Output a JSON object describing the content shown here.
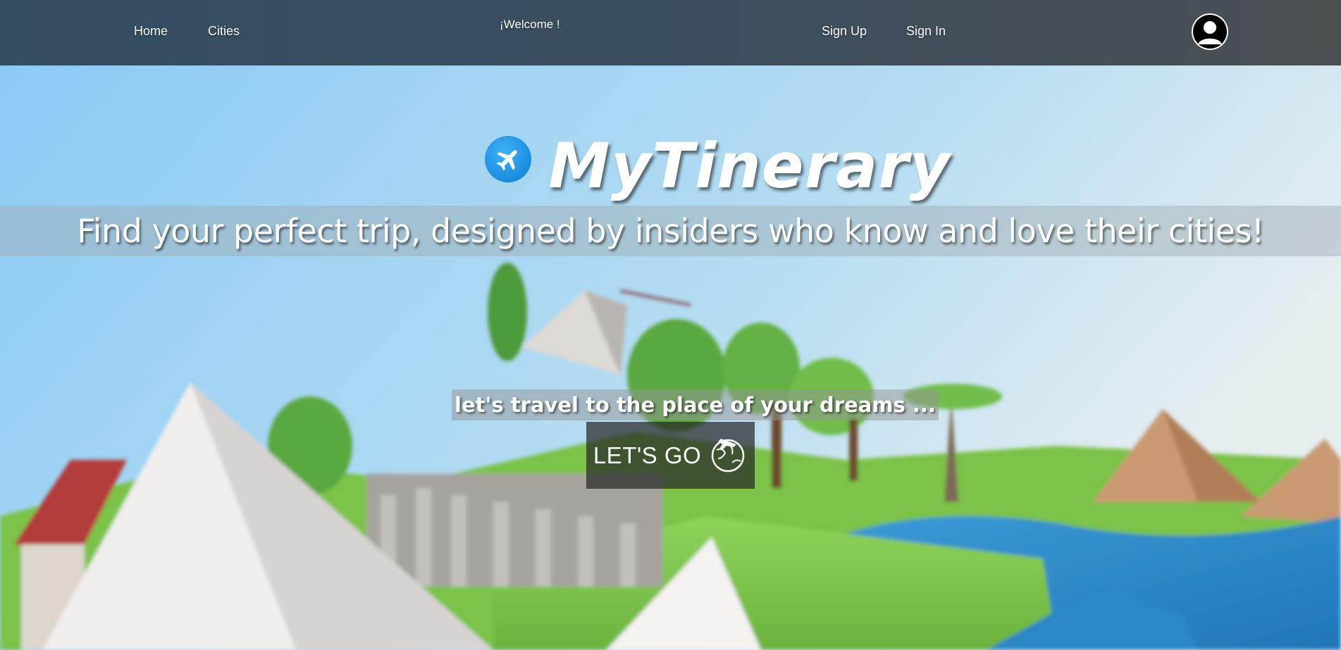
{
  "navbar": {
    "home_label": "Home",
    "cities_label": "Cities",
    "welcome_text": "¡Welcome !",
    "signup_label": "Sign Up",
    "signin_label": "Sign In",
    "avatar_icon": "user-avatar-icon"
  },
  "hero": {
    "logo_icon": "airplane-icon",
    "brand_title": "MyTinerary",
    "tagline": "Find your perfect trip, designed by insiders who know and love their cities!",
    "cta_subtitle": "let's travel to the place of your dreams ...",
    "cta_button_label": "LET'S GO",
    "cta_icon": "globe-travel-icon"
  },
  "colors": {
    "navbar_start": "#334d63",
    "navbar_end": "#4b4f52",
    "logo_blue": "#1b8be0",
    "text": "#ffffff"
  }
}
